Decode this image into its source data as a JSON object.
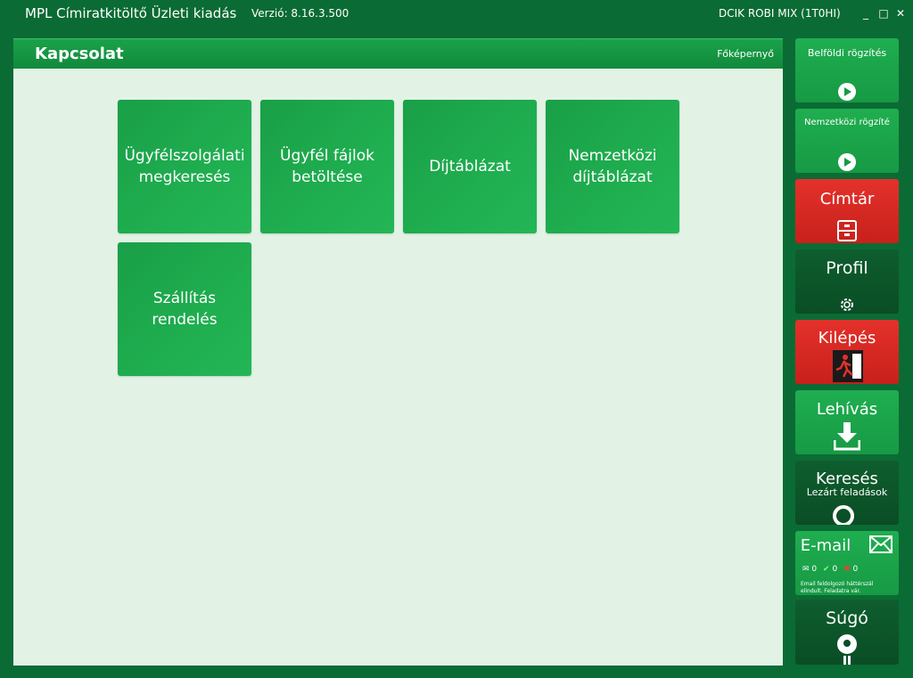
{
  "window": {
    "title": "MPL Címiratkitöltő Üzleti kiadás",
    "version": "Verzió: 8.16.3.500",
    "user": "DCIK ROBI MIX  (1T0HI)",
    "minimize": "_",
    "maximize": "□",
    "close": "✕"
  },
  "main": {
    "title": "Kapcsolat",
    "home_link": "Főképernyő",
    "tiles": [
      {
        "label": "Ügyfélszolgálati megkeresés"
      },
      {
        "label": "Ügyfél fájlok betöltése"
      },
      {
        "label": "Díjtáblázat"
      },
      {
        "label": "Nemzetközi díjtáblázat"
      },
      {
        "label": "Szállítás rendelés"
      }
    ]
  },
  "sidebar": {
    "domestic": {
      "label": "Belföldi rögzítés",
      "icon": "play-icon"
    },
    "international": {
      "label": "Nemzetközi rögzíté",
      "icon": "play-icon"
    },
    "address_book": {
      "label": "Címtár",
      "icon": "cabinet-icon"
    },
    "profile": {
      "label": "Profil",
      "icon": "gear-icon"
    },
    "logout": {
      "label": "Kilépés",
      "icon": "exit-icon"
    },
    "download": {
      "label": "Lehívás",
      "icon": "download-icon"
    },
    "search": {
      "label": "Keresés",
      "sublabel": "Lezárt feladások",
      "icon": "search-icon"
    },
    "email": {
      "label": "E-mail",
      "icon": "envelope-icon",
      "count_mail": "0",
      "count_ok": "0",
      "count_error": "0",
      "note": "Email feldolgozó háttérszál elindult. Feladatra vár."
    },
    "help": {
      "label": "Súgó",
      "icon": "info-icon"
    }
  },
  "colors": {
    "frame": "#0b6b34",
    "tile": "#1fae50",
    "panel": "#e2f3e6",
    "red": "#e4312b",
    "dark": "#0e5e2e"
  }
}
